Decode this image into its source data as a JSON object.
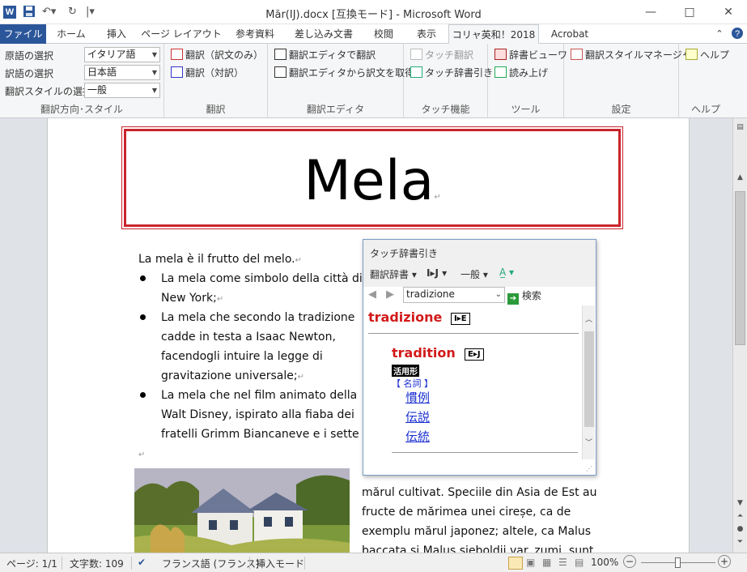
{
  "window": {
    "title": "Măr(IJ).docx [互換モード] - Microsoft Word",
    "app_icon": "W",
    "minimize": "—",
    "maximize": "□",
    "close": "✕"
  },
  "tabs": [
    {
      "label": "ファイル"
    },
    {
      "label": "ホーム"
    },
    {
      "label": "挿入"
    },
    {
      "label": "ページ レイアウト"
    },
    {
      "label": "参考資料"
    },
    {
      "label": "差し込み文書"
    },
    {
      "label": "校閲"
    },
    {
      "label": "表示"
    },
    {
      "label": "コリャ英和！2018"
    },
    {
      "label": "Acrobat"
    }
  ],
  "ribbon": {
    "direction_group": {
      "label": "翻訳方向･スタイル",
      "source_label": "原語の選択",
      "source_value": "イタリア語",
      "target_label": "訳語の選択",
      "target_value": "日本語",
      "style_label": "翻訳スタイルの選択",
      "style_value": "一般"
    },
    "translate_group": {
      "label": "翻訳",
      "btn_translation_only": "翻訳（訳文のみ）",
      "btn_parallel": "翻訳（対訳）"
    },
    "editor_group": {
      "label": "翻訳エディタ",
      "btn_open_editor": "翻訳エディタで翻訳",
      "btn_get_from_editor": "翻訳エディタから訳文を取得"
    },
    "touch_group": {
      "label": "タッチ機能",
      "btn_touch_translate": "タッチ翻訳",
      "btn_touch_dictionary": "タッチ辞書引き"
    },
    "tools_group": {
      "label": "ツール",
      "btn_dictionary_viewer": "辞書ビューワ",
      "btn_read_aloud": "読み上げ"
    },
    "settings_group": {
      "label": "設定",
      "btn_style_manager": "翻訳スタイルマネージャ"
    },
    "help_group": {
      "label": "ヘルプ",
      "btn_help": "ヘルプ"
    }
  },
  "document": {
    "title": "Mela",
    "intro": "La mela è il frutto del melo.",
    "bullets": [
      [
        "La mela come simbolo della città di",
        "New York;"
      ],
      [
        "La mela che secondo la tradizione",
        "cadde in testa a Isaac Newton,",
        "facendogli intuire la legge di",
        "gravitazione universale;"
      ],
      [
        "La mela che nel film animato della",
        "Walt Disney, ispirato alla fiaba dei",
        "fratelli Grimm Biancaneve e i sette na"
      ]
    ],
    "right_column": [
      "mărul cultivat. Speciile din Asia de Est au",
      "fructe de mărimea unei cireșe, ca de",
      "exemplu mărul japonez; altele, ca Malus",
      "baccata și Malus sieboldii var. zumi, sunt"
    ]
  },
  "popup": {
    "title": "タッチ辞書引き",
    "toolbar_dict": "翻訳辞書",
    "toolbar_dir": "I▸J",
    "toolbar_style": "一般",
    "search_value": "tradizione",
    "search_button": "検索",
    "headword": "tradizione",
    "headword_badge": "I▸E",
    "entry_word": "tradition",
    "entry_badge": "E▸J",
    "inflection_label": "活用形",
    "pos": "【 名詞 】",
    "translations": [
      "慣例",
      "伝説",
      "伝統"
    ]
  },
  "status": {
    "page": "ページ: 1/1",
    "words": "文字数: 109",
    "language": "フランス語 (フランス)",
    "mode": "挿入モード",
    "zoom": "100%",
    "zoom_minus": "−",
    "zoom_plus": "+"
  }
}
